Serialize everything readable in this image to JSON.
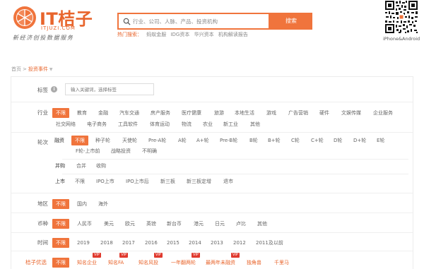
{
  "header": {
    "logo_text": "IT桔子",
    "logo_domain": "ITJUZI.COM",
    "logo_slogan": "新经济创投数据服务",
    "search_placeholder": "行业、公司、人脉、产品、投资机构",
    "search_button": "搜索",
    "hot_label": "热门搜索：",
    "hot_links": [
      "蚂蚁金服",
      "IDG资本",
      "华兴资本",
      "机构解读报告"
    ],
    "qr_caption": "iPhone&Android"
  },
  "breadcrumb": {
    "home": "首页",
    "separator": ">",
    "current": "投资事件"
  },
  "filters": {
    "tags": {
      "label": "标签",
      "input_placeholder": "输入关键词，选择标签"
    },
    "industry": {
      "label": "行业",
      "options_row1": [
        "不限",
        "教育",
        "金融",
        "汽车交通",
        "房产服务",
        "医疗健康",
        "旅游",
        "本地生活",
        "游戏",
        "广告营销",
        "硬件",
        "文娱传媒",
        "企业服务"
      ],
      "options_row2": [
        "社交网络",
        "电子商务",
        "工具软件",
        "体育运动",
        "物流",
        "农业",
        "新工业",
        "其他"
      ]
    },
    "round": {
      "label": "轮次",
      "financing_label": "融资",
      "financing_row1": [
        "不限",
        "种子轮",
        "天使轮",
        "Pre-A轮",
        "A轮",
        "A+轮",
        "Pre-B轮",
        "B轮",
        "B+轮",
        "C轮",
        "C+轮",
        "D轮",
        "D+轮",
        "E轮"
      ],
      "financing_row2": [
        "F轮-上市前",
        "战略投资",
        "不明确"
      ],
      "merger_label": "并购",
      "merger_options": [
        "合并",
        "收购"
      ],
      "ipo_label": "上市",
      "ipo_options": [
        "不限",
        "IPO上市",
        "IPO上市后",
        "新三板",
        "新三板定增",
        "退市"
      ]
    },
    "region": {
      "label": "地区",
      "options": [
        "不限",
        "国内",
        "海外"
      ]
    },
    "currency": {
      "label": "币种",
      "options": [
        "不限",
        "人民币",
        "美元",
        "欧元",
        "英镑",
        "新台币",
        "港元",
        "日元",
        "卢比",
        "其他"
      ]
    },
    "time": {
      "label": "时间",
      "options": [
        "不限",
        "2019",
        "2018",
        "2017",
        "2016",
        "2015",
        "2014",
        "2013",
        "2012",
        "2011及以前"
      ]
    },
    "juzi_select": {
      "label": "桔子优选",
      "options": [
        "不限",
        "知名企业",
        "知名FA",
        "知名风投",
        "一年翻两轮",
        "最两年未融资",
        "独角兽",
        "千里马"
      ],
      "vip_badge": "VIP",
      "vip_flags": [
        false,
        true,
        true,
        true,
        true,
        true,
        false,
        false
      ]
    }
  },
  "colors": {
    "accent": "#f0743c",
    "brand": "#e8652c",
    "vip": "#e03a2e"
  }
}
